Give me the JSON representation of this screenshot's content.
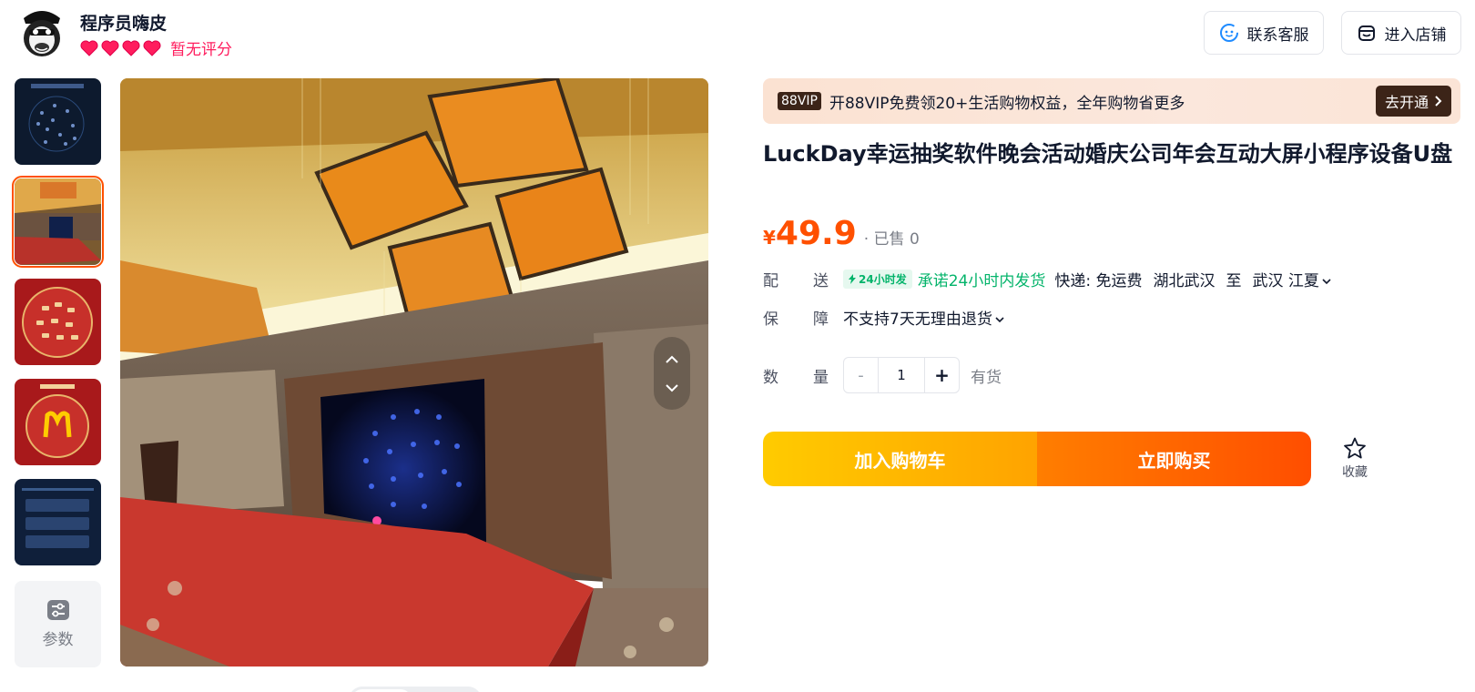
{
  "shop": {
    "name": "程序员嗨皮",
    "rating_text": "暂无评分",
    "hearts": 4
  },
  "header_buttons": {
    "service": "联系客服",
    "enter_shop": "进入店铺"
  },
  "gallery": {
    "params_label": "参数",
    "active_index": 1,
    "thumbnails": [
      "lottery-sphere-dark",
      "banquet-hall-photo",
      "red-lottery-circle",
      "macbook-red-poster",
      "settings-panel-dark"
    ]
  },
  "vip": {
    "badge": "88VIP",
    "text": "开88VIP免费领20+生活购物权益，全年购物省更多",
    "button": "去开通"
  },
  "product": {
    "title": "LuckDay幸运抽奖软件晚会活动婚庆公司年会互动大屏小程序设备U盘",
    "currency": "¥",
    "price": "49.9",
    "sold": "· 已售 0"
  },
  "delivery": {
    "key1": "配",
    "key2": "送",
    "tag": "24小时发",
    "promise": "承诺24小时内发货",
    "courier": "快递: 免运费",
    "from": "湖北武汉",
    "to_word": "至",
    "to": "武汉 江夏"
  },
  "guarantee": {
    "key1": "保",
    "key2": "障",
    "value": "不支持7天无理由退货"
  },
  "quantity": {
    "key1": "数",
    "key2": "量",
    "minus": "-",
    "value": "1",
    "plus": "+",
    "stock": "有货"
  },
  "actions": {
    "add_cart": "加入购物车",
    "buy_now": "立即购买",
    "favorite": "收藏"
  },
  "colors": {
    "accent": "#ff5000",
    "green": "#04b46b",
    "heart": "#ff1d5e"
  }
}
